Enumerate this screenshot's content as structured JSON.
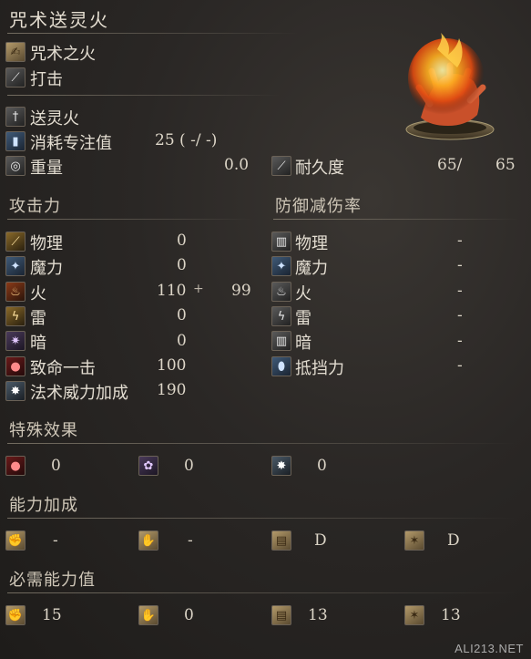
{
  "title": "咒术送灵火",
  "header_rows": [
    {
      "icon": "pyromancy-scroll-icon",
      "label": "咒术之火"
    },
    {
      "icon": "strike-icon",
      "label": "打击"
    }
  ],
  "spell_rows": [
    {
      "icon": "spell-icon",
      "label": "送灵火"
    },
    {
      "icon": "fp-icon",
      "label": "消耗专注值",
      "value": "25 (  -/  -)"
    },
    {
      "icon": "weight-icon",
      "label": "重量",
      "value": "0.0"
    }
  ],
  "durability": {
    "icon": "durability-icon",
    "label": "耐久度",
    "current": "65/",
    "max": "65"
  },
  "attack": {
    "title": "攻击力",
    "rows": [
      {
        "icon": "physical-icon",
        "label": "物理",
        "value": "0",
        "bonus": ""
      },
      {
        "icon": "magic-icon",
        "label": "魔力",
        "value": "0",
        "bonus": ""
      },
      {
        "icon": "fire-icon",
        "label": "火",
        "value": "110",
        "bonus": "+",
        "extra": "99"
      },
      {
        "icon": "lightning-icon",
        "label": "雷",
        "value": "0",
        "bonus": ""
      },
      {
        "icon": "dark-icon",
        "label": "暗",
        "value": "0",
        "bonus": ""
      },
      {
        "icon": "critical-icon",
        "label": "致命一击",
        "value": "100",
        "bonus": ""
      },
      {
        "icon": "spell-buff-icon",
        "label": "法术威力加成",
        "value": "190",
        "bonus": ""
      }
    ]
  },
  "defense": {
    "title": "防御减伤率",
    "rows": [
      {
        "icon": "physical-defense-icon",
        "label": "物理",
        "value": "-"
      },
      {
        "icon": "magic-defense-icon",
        "label": "魔力",
        "value": "-"
      },
      {
        "icon": "fire-defense-icon",
        "label": "火",
        "value": "-"
      },
      {
        "icon": "lightning-defense-icon",
        "label": "雷",
        "value": "-"
      },
      {
        "icon": "dark-defense-icon",
        "label": "暗",
        "value": "-"
      },
      {
        "icon": "stability-icon",
        "label": "抵挡力",
        "value": "-"
      }
    ]
  },
  "effects": {
    "title": "特殊效果",
    "items": [
      {
        "icon": "bleed-icon",
        "value": "0"
      },
      {
        "icon": "poison-icon",
        "value": "0"
      },
      {
        "icon": "frost-icon",
        "value": "0"
      }
    ]
  },
  "scaling": {
    "title": "能力加成",
    "items": [
      {
        "icon": "strength-icon",
        "value": "-"
      },
      {
        "icon": "dexterity-icon",
        "value": "-"
      },
      {
        "icon": "intelligence-icon",
        "value": "D"
      },
      {
        "icon": "faith-icon",
        "value": "D"
      }
    ]
  },
  "requirements": {
    "title": "必需能力值",
    "items": [
      {
        "icon": "strength-icon",
        "value": "15"
      },
      {
        "icon": "dexterity-icon",
        "value": "0"
      },
      {
        "icon": "intelligence-icon",
        "value": "13"
      },
      {
        "icon": "faith-icon",
        "value": "13"
      }
    ]
  },
  "watermark": "ALI213.NET",
  "colors": {
    "background": "#2a2725",
    "text": "#d8d2c6",
    "accent_fire": "#e0521a"
  }
}
